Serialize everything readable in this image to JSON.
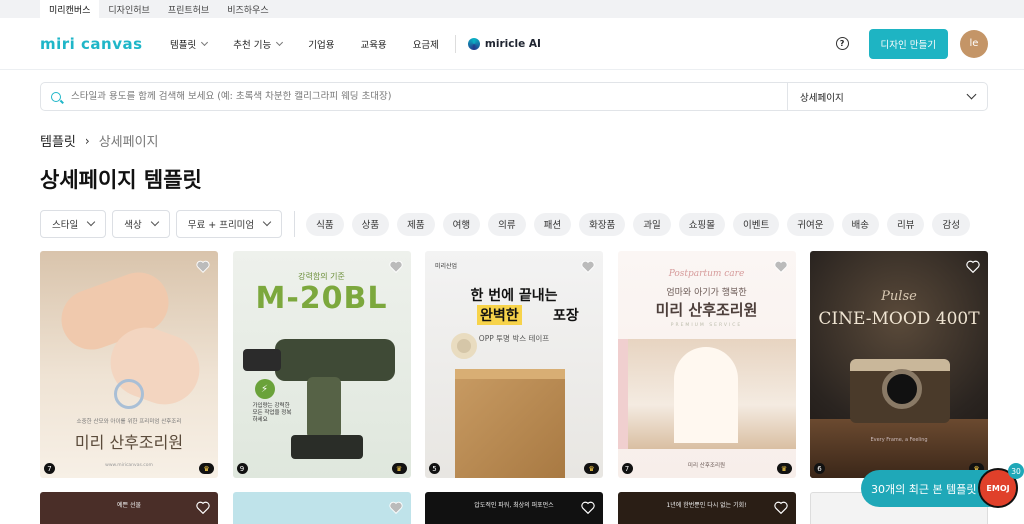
{
  "top_tabs": [
    "미리캔버스",
    "디자인허브",
    "프린트허브",
    "비즈하우스"
  ],
  "header": {
    "logo": "miri canvas",
    "nav": [
      {
        "label": "템플릿",
        "dropdown": true
      },
      {
        "label": "추천 기능",
        "dropdown": true
      },
      {
        "label": "기업용",
        "dropdown": false
      },
      {
        "label": "교육용",
        "dropdown": false
      },
      {
        "label": "요금제",
        "dropdown": false
      }
    ],
    "brand2": "miricle AI",
    "help": "?",
    "make_button": "디자인 만들기",
    "avatar_initials": "le"
  },
  "search": {
    "placeholder": "스타일과 용도를 함께 검색해 보세요 (예: 초록색 차분한 캘리그라피 웨딩 초대장)",
    "category": "상세페이지"
  },
  "breadcrumb": {
    "root": "템플릿",
    "sep": "›",
    "current": "상세페이지"
  },
  "page_title": "상세페이지 템플릿",
  "filters": [
    "스타일",
    "색상",
    "무료 + 프리미엄"
  ],
  "chips": [
    "식품",
    "상품",
    "제품",
    "여행",
    "의류",
    "패션",
    "화장품",
    "과일",
    "쇼핑몰",
    "이벤트",
    "귀여운",
    "배송",
    "리뷰",
    "감성"
  ],
  "cards": [
    {
      "pages": "7",
      "small": "소중한 산모와 아이를 위한 프리미엄 산후조리",
      "title": "미리 산후조리원",
      "foot": "www.miricanvas.com"
    },
    {
      "pages": "9",
      "tag": "강력함의 기준",
      "title": "M-20BL",
      "blurb": "가입량는 강력한\n모든 작업을 정복\n하세요"
    },
    {
      "pages": "5",
      "logo": "미리산업",
      "line1": "한 번에 끝내는",
      "line2a": "완벽한",
      "line2b": "포장",
      "sub": "OPP 투명 박스 테이프"
    },
    {
      "pages": "7",
      "script": "Postpartum care",
      "sub": "엄마와 아기가 행복한",
      "title": "미리 산후조리원",
      "tiny": "PREMIUM SERVICE",
      "foot": "미리 산후조리원"
    },
    {
      "pages": "6",
      "script": "Pulse",
      "title": "CINE-MOOD 400T",
      "foot": "Every Frame, a Feeling"
    }
  ],
  "row2_texts": [
    "예쁜 선물",
    "",
    "압도적인 파워, 최상의 퍼포먼스",
    "1년에 한번뿐인 다시 없는 기회!",
    ""
  ],
  "floating_button": "30개의 최근 본 템플릿",
  "moji": {
    "label": "EMOJ",
    "badge": "30"
  }
}
